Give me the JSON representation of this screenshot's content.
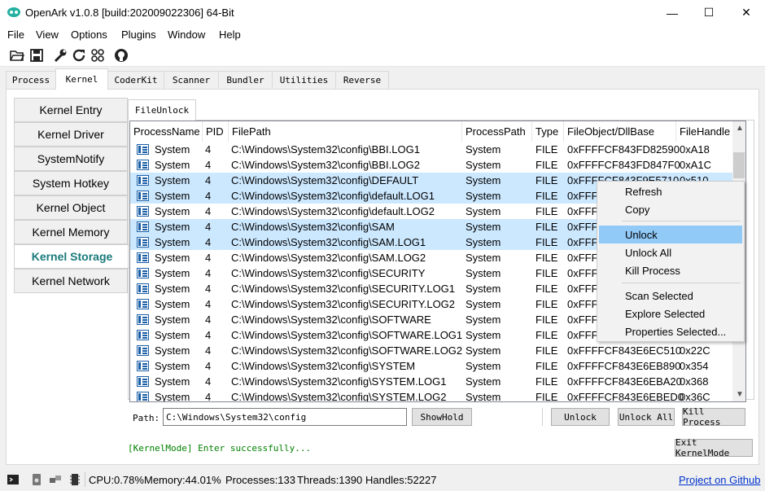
{
  "window": {
    "title": "OpenArk v1.0.8  [build:202009022306]  64-Bit",
    "minimize": "—",
    "maximize": "☐",
    "close": "✕"
  },
  "menu": [
    "File",
    "View",
    "Options",
    "Plugins",
    "Window",
    "Help"
  ],
  "toolbar_icons": [
    "open-folder-icon",
    "save-icon",
    "wrench-icon",
    "refresh-icon",
    "grid-icon",
    "github-icon"
  ],
  "tabs": [
    "Process",
    "Kernel",
    "CoderKit",
    "Scanner",
    "Bundler",
    "Utilities",
    "Reverse"
  ],
  "active_tab": "Kernel",
  "sidebar": [
    "Kernel Entry",
    "Kernel Driver",
    "SystemNotify",
    "System Hotkey",
    "Kernel Object",
    "Kernel Memory",
    "Kernel Storage",
    "Kernel Network"
  ],
  "active_sidebar": "Kernel Storage",
  "subtab": "FileUnlock",
  "table": {
    "columns": [
      "ProcessName",
      "PID",
      "FilePath",
      "ProcessPath",
      "Type",
      "FileObject/DllBase",
      "FileHandle"
    ],
    "rows": [
      {
        "name": "System",
        "pid": "4",
        "path": "C:\\Windows\\System32\\config\\BBI.LOG1",
        "ppath": "System",
        "type": "FILE",
        "fo": "0xFFFFCF843FD82590",
        "fh": "0xA18",
        "sel": false
      },
      {
        "name": "System",
        "pid": "4",
        "path": "C:\\Windows\\System32\\config\\BBI.LOG2",
        "ppath": "System",
        "type": "FILE",
        "fo": "0xFFFFCF843FD847F0",
        "fh": "0xA1C",
        "sel": false
      },
      {
        "name": "System",
        "pid": "4",
        "path": "C:\\Windows\\System32\\config\\DEFAULT",
        "ppath": "System",
        "type": "FILE",
        "fo": "0xFFFFCF843F9E5710",
        "fh": "0x510",
        "sel": true
      },
      {
        "name": "System",
        "pid": "4",
        "path": "C:\\Windows\\System32\\config\\default.LOG1",
        "ppath": "System",
        "type": "FILE",
        "fo": "0xFFFF",
        "fh": "",
        "sel": true
      },
      {
        "name": "System",
        "pid": "4",
        "path": "C:\\Windows\\System32\\config\\default.LOG2",
        "ppath": "System",
        "type": "FILE",
        "fo": "0xFFFF",
        "fh": "",
        "sel": false
      },
      {
        "name": "System",
        "pid": "4",
        "path": "C:\\Windows\\System32\\config\\SAM",
        "ppath": "System",
        "type": "FILE",
        "fo": "0xFFFF",
        "fh": "",
        "sel": true
      },
      {
        "name": "System",
        "pid": "4",
        "path": "C:\\Windows\\System32\\config\\SAM.LOG1",
        "ppath": "System",
        "type": "FILE",
        "fo": "0xFFFF",
        "fh": "",
        "sel": true
      },
      {
        "name": "System",
        "pid": "4",
        "path": "C:\\Windows\\System32\\config\\SAM.LOG2",
        "ppath": "System",
        "type": "FILE",
        "fo": "0xFFFF",
        "fh": "",
        "sel": false
      },
      {
        "name": "System",
        "pid": "4",
        "path": "C:\\Windows\\System32\\config\\SECURITY",
        "ppath": "System",
        "type": "FILE",
        "fo": "0xFFFF",
        "fh": "",
        "sel": false
      },
      {
        "name": "System",
        "pid": "4",
        "path": "C:\\Windows\\System32\\config\\SECURITY.LOG1",
        "ppath": "System",
        "type": "FILE",
        "fo": "0xFFFF",
        "fh": "",
        "sel": false
      },
      {
        "name": "System",
        "pid": "4",
        "path": "C:\\Windows\\System32\\config\\SECURITY.LOG2",
        "ppath": "System",
        "type": "FILE",
        "fo": "0xFFFF",
        "fh": "",
        "sel": false
      },
      {
        "name": "System",
        "pid": "4",
        "path": "C:\\Windows\\System32\\config\\SOFTWARE",
        "ppath": "System",
        "type": "FILE",
        "fo": "0xFFFF",
        "fh": "",
        "sel": false
      },
      {
        "name": "System",
        "pid": "4",
        "path": "C:\\Windows\\System32\\config\\SOFTWARE.LOG1",
        "ppath": "System",
        "type": "FILE",
        "fo": "0xFFFF",
        "fh": "",
        "sel": false
      },
      {
        "name": "System",
        "pid": "4",
        "path": "C:\\Windows\\System32\\config\\SOFTWARE.LOG2",
        "ppath": "System",
        "type": "FILE",
        "fo": "0xFFFFCF843E6EC510",
        "fh": "0x22C",
        "sel": false
      },
      {
        "name": "System",
        "pid": "4",
        "path": "C:\\Windows\\System32\\config\\SYSTEM",
        "ppath": "System",
        "type": "FILE",
        "fo": "0xFFFFCF843E6EB890",
        "fh": "0x354",
        "sel": false
      },
      {
        "name": "System",
        "pid": "4",
        "path": "C:\\Windows\\System32\\config\\SYSTEM.LOG1",
        "ppath": "System",
        "type": "FILE",
        "fo": "0xFFFFCF843E6EBA20",
        "fh": "0x368",
        "sel": false
      },
      {
        "name": "System",
        "pid": "4",
        "path": "C:\\Windows\\System32\\config\\SYSTEM.LOG2",
        "ppath": "System",
        "type": "FILE",
        "fo": "0xFFFFCF843E6EBED0",
        "fh": "0x36C",
        "sel": false
      }
    ]
  },
  "context_menu": {
    "items": [
      "Refresh",
      "Copy",
      "Unlock",
      "Unlock All",
      "Kill Process",
      "Scan Selected",
      "Explore Selected",
      "Properties Selected..."
    ],
    "highlighted": "Unlock"
  },
  "path_bar": {
    "label": "Path:",
    "value": "C:\\Windows\\System32\\config",
    "showhold": "ShowHold",
    "unlock": "Unlock",
    "unlock_all": "Unlock All",
    "kill_process": "Kill Process"
  },
  "log": "[KernelMode] Enter successfully...",
  "exit_kernel_mode": "Exit KernelMode",
  "status": {
    "cpu": "CPU:0.78%",
    "memory": "Memory:44.01%",
    "processes": "Processes:133",
    "threads": "Threads:1390",
    "handles": "Handles:52227",
    "link": "Project on Github"
  },
  "colors": {
    "selection": "#cce8ff",
    "menu_highlight": "#91c9f7",
    "active_sidebar": "#1a7a7a",
    "log": "#008000",
    "link": "#0033cc"
  }
}
